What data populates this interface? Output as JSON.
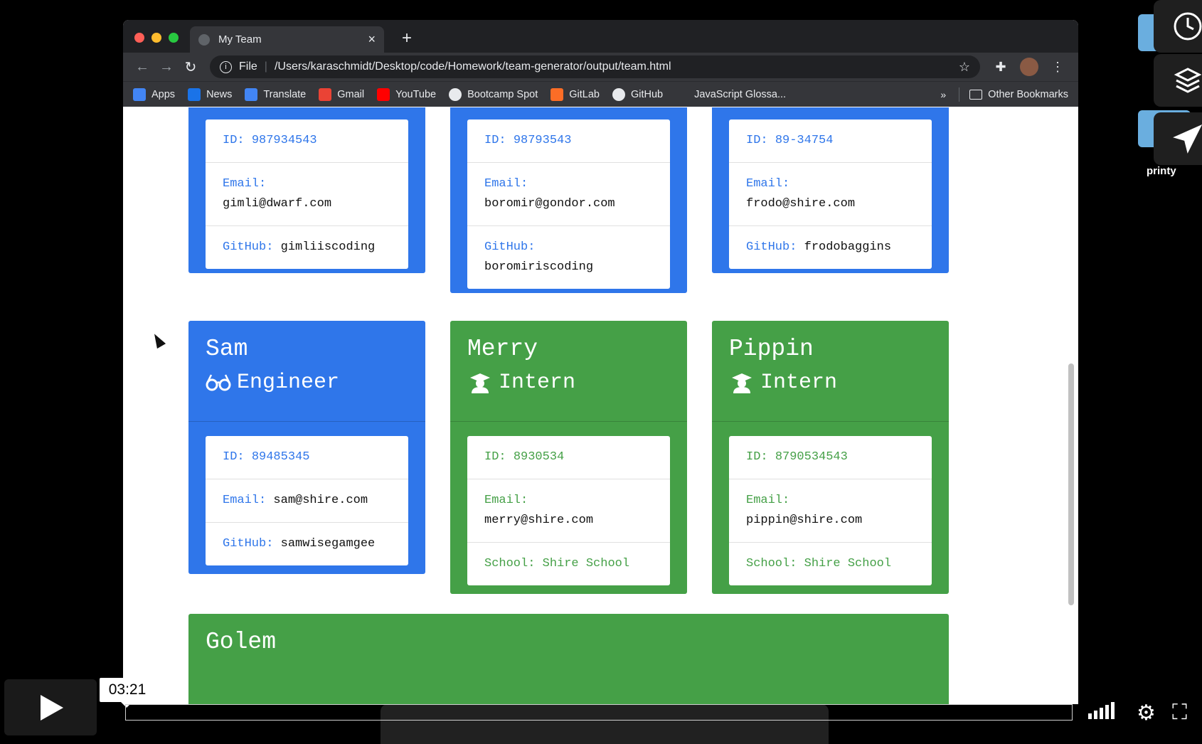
{
  "browser": {
    "tab_title": "My Team",
    "new_tab": "+",
    "tab_close": "×",
    "url_scheme": "File",
    "url": "/Users/karaschmidt/Desktop/code/Homework/team-generator/output/team.html",
    "bookmarks": [
      {
        "label": "Apps",
        "color": "#4285f4"
      },
      {
        "label": "News",
        "color": "#1a73e8"
      },
      {
        "label": "Translate",
        "color": "#4285f4"
      },
      {
        "label": "Gmail",
        "color": "#ea4335"
      },
      {
        "label": "YouTube",
        "color": "#ff0000"
      },
      {
        "label": "Bootcamp Spot",
        "color": "#e8eaed"
      },
      {
        "label": "GitLab",
        "color": "#fc6d26"
      },
      {
        "label": "GitHub",
        "color": "#e8eaed"
      },
      {
        "label": "JavaScript Glossa...",
        "color": "#35363a"
      }
    ],
    "bookmarks_more": "»",
    "other_bookmarks": "Other Bookmarks"
  },
  "team": {
    "top_row": [
      {
        "id_label": "ID:",
        "id": "987934543",
        "email_label": "Email:",
        "email": "gimli@dwarf.com",
        "extra_label": "GitHub:",
        "extra": "gimliiscoding"
      },
      {
        "id_label": "ID:",
        "id": "98793543",
        "email_label": "Email:",
        "email": "boromir@gondor.com",
        "extra_label": "GitHub:",
        "extra": "boromiriscoding"
      },
      {
        "id_label": "ID:",
        "id": "89-34754",
        "email_label": "Email:",
        "email": "frodo@shire.com",
        "extra_label": "GitHub:",
        "extra": "frodobaggins"
      }
    ],
    "middle_row": [
      {
        "name": "Sam",
        "role": "Engineer",
        "id_label": "ID:",
        "id": "89485345",
        "email_label": "Email:",
        "email": "sam@shire.com",
        "extra_label": "GitHub:",
        "extra": "samwisegamgee"
      },
      {
        "name": "Merry",
        "role": "Intern",
        "id_label": "ID:",
        "id": "8930534",
        "email_label": "Email:",
        "email": "merry@shire.com",
        "extra_label": "School:",
        "extra": "Shire School"
      },
      {
        "name": "Pippin",
        "role": "Intern",
        "id_label": "ID:",
        "id": "8790534543",
        "email_label": "Email:",
        "email": "pippin@shire.com",
        "extra_label": "School:",
        "extra": "Shire School"
      }
    ],
    "bottom": {
      "name": "Golem"
    }
  },
  "desktop": {
    "folder_label": "printy"
  },
  "video": {
    "timestamp": "03:21"
  },
  "colors": {
    "engineer": "#2f76ea",
    "intern": "#45a047"
  }
}
